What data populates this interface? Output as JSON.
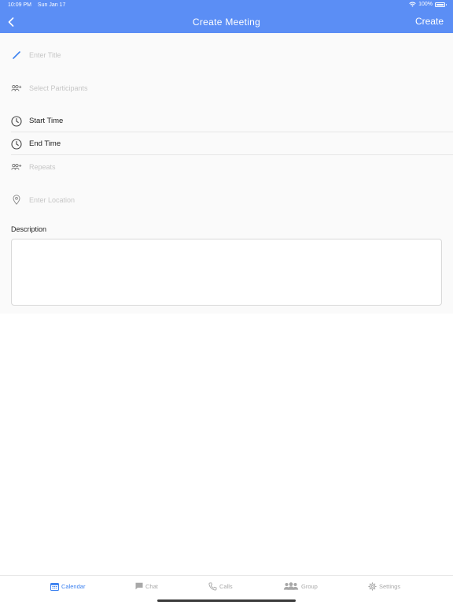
{
  "status_bar": {
    "time": "10:09 PM",
    "date": "Sun Jan 17",
    "battery": "100%"
  },
  "nav": {
    "title": "Create Meeting",
    "action_label": "Create"
  },
  "form": {
    "title_placeholder": "Enter Title",
    "participants_placeholder": "Select Participants",
    "start_time_label": "Start Time",
    "end_time_label": "End Time",
    "repeats_placeholder": "Repeats",
    "location_placeholder": "Enter Location",
    "description_label": "Description",
    "description_value": ""
  },
  "tabs": [
    {
      "label": "Calendar",
      "icon": "calendar-icon",
      "active": true
    },
    {
      "label": "Chat",
      "icon": "chat-icon",
      "active": false
    },
    {
      "label": "Calls",
      "icon": "phone-icon",
      "active": false
    },
    {
      "label": "Group",
      "icon": "group-icon",
      "active": false
    },
    {
      "label": "Settings",
      "icon": "gear-icon",
      "active": false
    }
  ],
  "colors": {
    "header": "#5b8ef5",
    "active_tab": "#3d82f0",
    "inactive_tab": "#a8a8a8",
    "form_bg": "#fafafa"
  }
}
